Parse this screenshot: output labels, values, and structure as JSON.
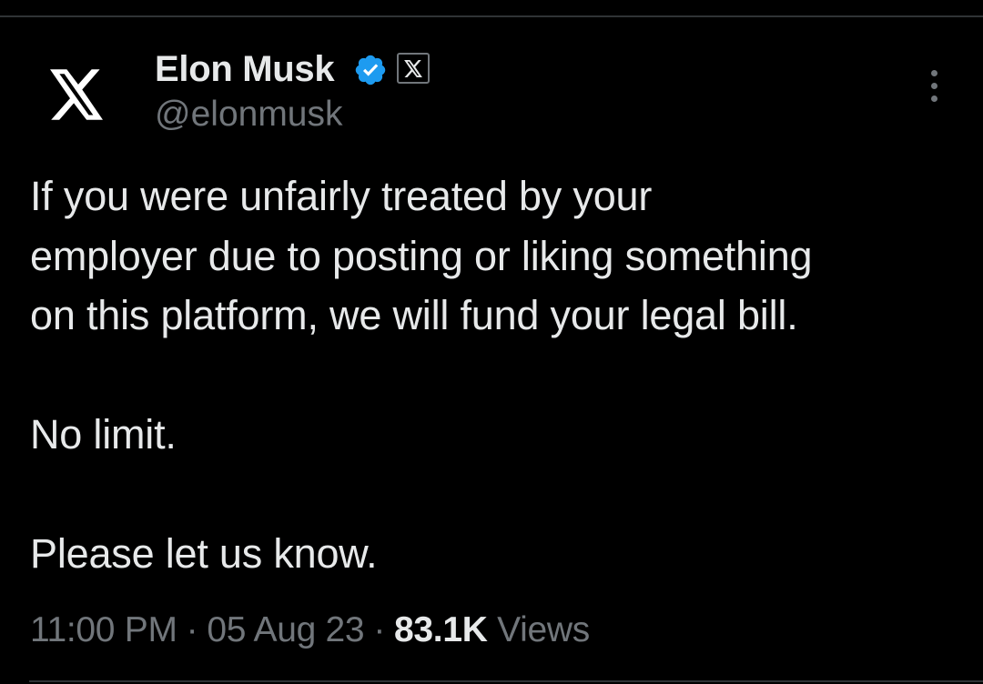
{
  "author": {
    "name": "Elon Musk",
    "handle": "@elonmusk",
    "avatar_icon": "x-logo-icon",
    "verified_icon": "verified-badge-icon",
    "verified_color": "#1d9bf0",
    "affiliate_icon": "x-affiliate-badge-icon"
  },
  "more_icon": "more-options-icon",
  "tweet": {
    "paragraphs": [
      "If you were unfairly treated by your\nemployer due to posting or liking something\non this platform, we will fund your legal bill.",
      "No limit.",
      "Please let us know."
    ]
  },
  "meta": {
    "time": "11:00 PM",
    "separator": "·",
    "date": "05 Aug 23",
    "views_count": "83.1K",
    "views_label": "Views"
  },
  "colors": {
    "background": "#000000",
    "text_primary": "#e7e9ea",
    "text_secondary": "#71767b",
    "divider": "#2f3336"
  }
}
